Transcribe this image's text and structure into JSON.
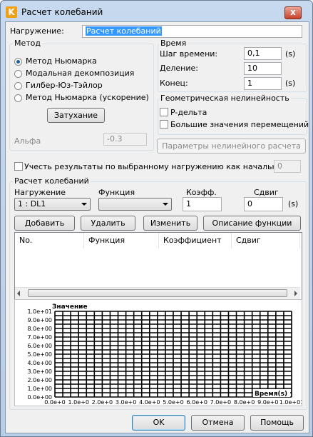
{
  "window": {
    "title": "Расчет колебаний",
    "close_glyph": "x"
  },
  "load": {
    "label": "Нагружение:",
    "value": "Расчет колебаний"
  },
  "method": {
    "group_title": "Метод",
    "options": [
      "Метод Ньюмарка",
      "Модальная декомпозиция",
      "Гилбер-Юз-Тэйлор",
      "Метод Ньюмарка (ускорение)"
    ],
    "selected_index": 0,
    "damping_button": "Затухание",
    "alpha_label": "Альфа",
    "alpha_value": "-0.3"
  },
  "time": {
    "group_title": "Время",
    "step_label": "Шаг времени:",
    "step_value": "0,1",
    "step_unit": "(s)",
    "division_label": "Деление:",
    "division_value": "10",
    "end_label": "Конец:",
    "end_value": "1",
    "end_unit": "(s)"
  },
  "nonlinear": {
    "group_title": "Геометрическая нелинейность",
    "pdelta": "P-дельта",
    "large_disp": "Большие значения перемещений",
    "params_button": "Параметры нелинейного расчета"
  },
  "initial": {
    "label": "Учесть результаты по выбранному нагружению как начальные",
    "value": "0"
  },
  "vibration": {
    "group_title": "Расчет колебаний",
    "load_label": "Нагружение",
    "load_value": "1 : DL1",
    "function_label": "Функция",
    "function_value": "",
    "coef_label": "Коэфф.",
    "coef_value": "1",
    "shift_label": "Сдвиг",
    "shift_value": "0",
    "shift_unit": "(s)",
    "buttons": {
      "add": "Добавить",
      "delete": "Удалить",
      "change": "Изменить",
      "describe": "Описание функции"
    },
    "columns": [
      "No.",
      "Функция",
      "Коэффициент",
      "Сдвиг"
    ]
  },
  "chart_data": {
    "type": "line",
    "title": "",
    "ylabel": "Значение",
    "xlabel": "Время(s)",
    "x_ticks": [
      "0.0e+0",
      "1.0e+0",
      "2.0e+0",
      "3.0e+0",
      "4.0e+0",
      "5.0e+0",
      "6.0e+0",
      "7.0e+0",
      "8.0e+0",
      "9.0e+0",
      "1.0e+01"
    ],
    "y_ticks": [
      "1.0e+01",
      "9.0e+00",
      "8.0e+00",
      "7.0e+00",
      "6.0e+00",
      "5.0e+00",
      "4.0e+00",
      "3.0e+00",
      "2.0e+00",
      "1.0e+00",
      "0.0e+00"
    ],
    "xlim": [
      0,
      10
    ],
    "ylim": [
      0,
      10
    ],
    "grid": true,
    "series": []
  },
  "footer": {
    "ok": "OK",
    "cancel": "Отмена",
    "help": "Помощь"
  }
}
